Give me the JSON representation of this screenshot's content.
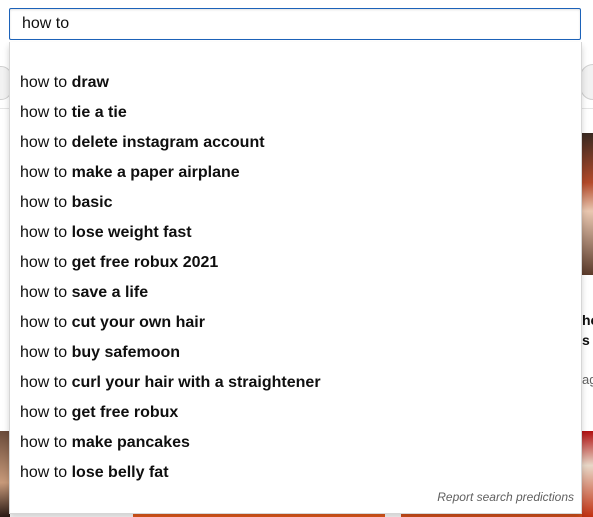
{
  "search": {
    "value": "how to"
  },
  "suggestions": [
    {
      "prefix": "how to ",
      "completion": "draw"
    },
    {
      "prefix": "how to ",
      "completion": "tie a tie"
    },
    {
      "prefix": "how to ",
      "completion": "delete instagram account"
    },
    {
      "prefix": "how to ",
      "completion": "make a paper airplane"
    },
    {
      "prefix": "how to ",
      "completion": "basic"
    },
    {
      "prefix": "how to ",
      "completion": "lose weight fast"
    },
    {
      "prefix": "how to ",
      "completion": "get free robux 2021"
    },
    {
      "prefix": "how to ",
      "completion": "save a life"
    },
    {
      "prefix": "how to ",
      "completion": "cut your own hair"
    },
    {
      "prefix": "how to ",
      "completion": "buy safemoon"
    },
    {
      "prefix": "how to ",
      "completion": "curl your hair with a straightener"
    },
    {
      "prefix": "how to ",
      "completion": "get free robux"
    },
    {
      "prefix": "how to ",
      "completion": "make pancakes"
    },
    {
      "prefix": "how to ",
      "completion": "lose belly fat"
    }
  ],
  "report_label": "Report search predictions",
  "background": {
    "side_title_line1": "he",
    "side_title_line2": "s",
    "side_meta": "ag"
  },
  "colors": {
    "focus_border": "#1c62b9",
    "text_primary": "#0f0f0f",
    "text_secondary": "#606060"
  }
}
